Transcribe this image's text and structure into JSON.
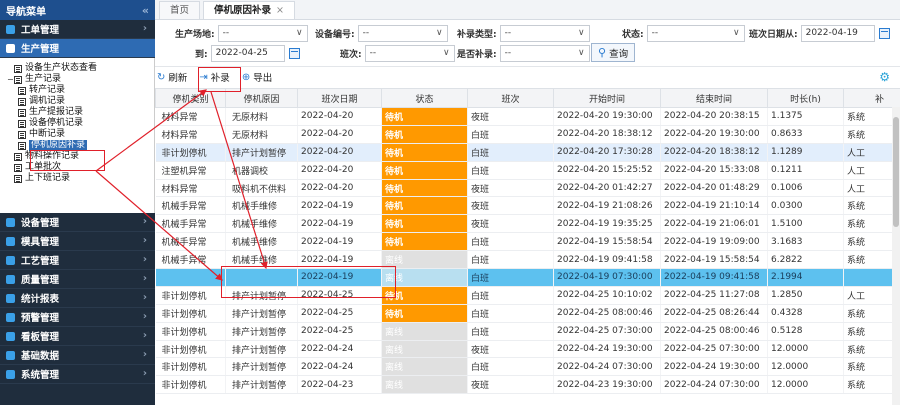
{
  "sidebar": {
    "title": "导航菜单",
    "collapse_icon": "«",
    "modules_top": [
      {
        "label": "工单管理",
        "icon_color": "#3aa0e8"
      },
      {
        "label": "生产管理",
        "icon_color": "#ffffff",
        "active": true
      }
    ],
    "tree": [
      {
        "label": "设备生产状态查看",
        "level": 0
      },
      {
        "label": "生产记录",
        "level": 0,
        "expanded": true
      },
      {
        "label": "转产记录",
        "level": 1
      },
      {
        "label": "调机记录",
        "level": 1
      },
      {
        "label": "生产提报记录",
        "level": 1
      },
      {
        "label": "设备停机记录",
        "level": 1
      },
      {
        "label": "中断记录",
        "level": 1
      },
      {
        "label": "停机原因补录",
        "level": 1,
        "selected": true
      },
      {
        "label": "物料操作记录",
        "level": 0
      },
      {
        "label": "工单批次",
        "level": 0
      },
      {
        "label": "上下班记录",
        "level": 0
      }
    ],
    "modules_bottom": [
      {
        "label": "设备管理",
        "icon_color": "#3aa0e8"
      },
      {
        "label": "模具管理",
        "icon_color": "#3aa0e8"
      },
      {
        "label": "工艺管理",
        "icon_color": "#3aa0e8"
      },
      {
        "label": "质量管理",
        "icon_color": "#3aa0e8"
      },
      {
        "label": "统计报表",
        "icon_color": "#3aa0e8"
      },
      {
        "label": "预警管理",
        "icon_color": "#3aa0e8"
      },
      {
        "label": "看板管理",
        "icon_color": "#3aa0e8"
      },
      {
        "label": "基础数据",
        "icon_color": "#3aa0e8"
      },
      {
        "label": "系统管理",
        "icon_color": "#3aa0e8"
      }
    ]
  },
  "tabs": [
    {
      "label": "首页"
    },
    {
      "label": "停机原因补录",
      "close": "×",
      "active": true
    }
  ],
  "filters": {
    "line_label": "生产场地:",
    "line_value": "--",
    "device_label": "设备编号:",
    "device_value": "--",
    "fill_type_label": "补录类型:",
    "fill_type_value": "--",
    "status_label": "状态:",
    "status_value": "--",
    "date_from_label": "班次日期从:",
    "date_from_value": "2022-04-19",
    "date_to_label": "到:",
    "date_to_value": "2022-04-25",
    "shift_label": "班次:",
    "shift_value": "--",
    "is_filled_label": "是否补录:",
    "is_filled_value": "--",
    "query_label": "查询"
  },
  "toolbar": {
    "refresh_label": "刷新",
    "fill_label": "补录",
    "export_label": "导出"
  },
  "colors": {
    "accent": "#2e6bb3",
    "status_orange": "#ff9900",
    "row_highlight": "#5dc1ef",
    "annotation_red": "#e0202a"
  },
  "table": {
    "columns": [
      "停机类别",
      "停机原因",
      "班次日期",
      "状态",
      "班次",
      "开始时间",
      "结束时间",
      "时长(h)",
      "补"
    ],
    "rows": [
      {
        "cells": [
          "材料异常",
          "无原材料",
          "2022-04-20",
          "待机",
          "夜班",
          "2022-04-20 19:30:00",
          "2022-04-20 20:38:15",
          "1.1375",
          "系统"
        ],
        "status": "orange"
      },
      {
        "cells": [
          "材料异常",
          "无原材料",
          "2022-04-20",
          "待机",
          "白班",
          "2022-04-20 18:38:12",
          "2022-04-20 19:30:00",
          "0.8633",
          "系统"
        ],
        "status": "orange"
      },
      {
        "cells": [
          "非计划停机",
          "排产计划暂停",
          "2022-04-20",
          "待机",
          "白班",
          "2022-04-20 17:30:28",
          "2022-04-20 18:38:12",
          "1.1289",
          "人工"
        ],
        "status": "orange",
        "highlight": true
      },
      {
        "cells": [
          "注塑机异常",
          "机器调校",
          "2022-04-20",
          "待机",
          "白班",
          "2022-04-20 15:25:52",
          "2022-04-20 15:33:08",
          "0.1211",
          "人工"
        ],
        "status": "orange"
      },
      {
        "cells": [
          "材料异常",
          "吸料机不供料",
          "2022-04-20",
          "待机",
          "夜班",
          "2022-04-20 01:42:27",
          "2022-04-20 01:48:29",
          "0.1006",
          "人工"
        ],
        "status": "orange"
      },
      {
        "cells": [
          "机械手异常",
          "机械手维修",
          "2022-04-19",
          "待机",
          "夜班",
          "2022-04-19 21:08:26",
          "2022-04-19 21:10:14",
          "0.0300",
          "系统"
        ],
        "status": "orange"
      },
      {
        "cells": [
          "机械手异常",
          "机械手维修",
          "2022-04-19",
          "待机",
          "夜班",
          "2022-04-19 19:35:25",
          "2022-04-19 21:06:01",
          "1.5100",
          "系统"
        ],
        "status": "orange"
      },
      {
        "cells": [
          "机械手异常",
          "机械手维修",
          "2022-04-19",
          "待机",
          "白班",
          "2022-04-19 15:58:54",
          "2022-04-19 19:09:00",
          "3.1683",
          "系统"
        ],
        "status": "orange"
      },
      {
        "cells": [
          "机械手异常",
          "机械手维修",
          "2022-04-19",
          "离线",
          "白班",
          "2022-04-19 09:41:58",
          "2022-04-19 15:58:54",
          "6.2822",
          "系统"
        ],
        "status": "gray"
      },
      {
        "cells": [
          "",
          "",
          "2022-04-19",
          "离线",
          "白班",
          "2022-04-19 07:30:00",
          "2022-04-19 09:41:58",
          "2.1994",
          ""
        ],
        "status": "gray",
        "selected": true
      },
      {
        "cells": [
          "非计划停机",
          "排产计划暂停",
          "2022-04-25",
          "待机",
          "白班",
          "2022-04-25 10:10:02",
          "2022-04-25 11:27:08",
          "1.2850",
          "人工"
        ],
        "status": "orange"
      },
      {
        "cells": [
          "非计划停机",
          "排产计划暂停",
          "2022-04-25",
          "待机",
          "白班",
          "2022-04-25 08:00:46",
          "2022-04-25 08:26:44",
          "0.4328",
          "系统"
        ],
        "status": "orange"
      },
      {
        "cells": [
          "非计划停机",
          "排产计划暂停",
          "2022-04-25",
          "离线",
          "白班",
          "2022-04-25 07:30:00",
          "2022-04-25 08:00:46",
          "0.5128",
          "系统"
        ],
        "status": "gray"
      },
      {
        "cells": [
          "非计划停机",
          "排产计划暂停",
          "2022-04-24",
          "离线",
          "夜班",
          "2022-04-24 19:30:00",
          "2022-04-25 07:30:00",
          "12.0000",
          "系统"
        ],
        "status": "gray"
      },
      {
        "cells": [
          "非计划停机",
          "排产计划暂停",
          "2022-04-24",
          "离线",
          "白班",
          "2022-04-24 07:30:00",
          "2022-04-24 19:30:00",
          "12.0000",
          "系统"
        ],
        "status": "gray"
      },
      {
        "cells": [
          "非计划停机",
          "排产计划暂停",
          "2022-04-23",
          "离线",
          "夜班",
          "2022-04-23 19:30:00",
          "2022-04-24 07:30:00",
          "12.0000",
          "系统"
        ],
        "status": "gray"
      }
    ]
  }
}
